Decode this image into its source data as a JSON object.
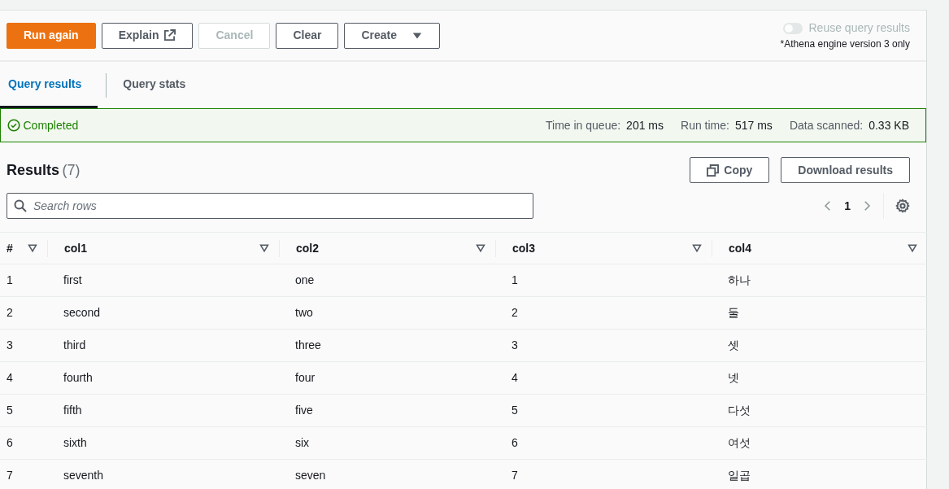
{
  "toolbar": {
    "buttons": [
      {
        "label": "Run again",
        "kind": "primary"
      },
      {
        "label": "Explain",
        "kind": "external"
      },
      {
        "label": "Cancel",
        "kind": "disabled"
      },
      {
        "label": "Clear",
        "kind": "plain"
      },
      {
        "label": "Create",
        "kind": "dropdown"
      }
    ],
    "reuse_toggle": {
      "label": "Reuse query results",
      "on": false,
      "disabled": true,
      "note": "*Athena engine version 3 only"
    }
  },
  "tabs": [
    {
      "label": "Query results",
      "selected": true
    },
    {
      "label": "Query stats",
      "selected": false
    }
  ],
  "status": {
    "label": "Completed",
    "stats": [
      {
        "label": "Time in queue:",
        "value": "201 ms"
      },
      {
        "label": "Run time:",
        "value": "517 ms"
      },
      {
        "label": "Data scanned:",
        "value": "0.33 KB"
      }
    ]
  },
  "results": {
    "title": "Results",
    "count": "(7)",
    "buttons": [
      {
        "label": "Copy",
        "kind": "copy"
      },
      {
        "label": "Download results",
        "kind": "plain"
      }
    ],
    "search": {
      "placeholder": "Search rows"
    },
    "page": "1"
  },
  "table": {
    "columns": [
      "#",
      "col1",
      "col2",
      "col3",
      "col4"
    ],
    "rows": [
      [
        "1",
        "first",
        "one",
        "1",
        "하나"
      ],
      [
        "2",
        "second",
        "two",
        "2",
        "둘"
      ],
      [
        "3",
        "third",
        "three",
        "3",
        "셋"
      ],
      [
        "4",
        "fourth",
        "four",
        "4",
        "넷"
      ],
      [
        "5",
        "fifth",
        "five",
        "5",
        "다섯"
      ],
      [
        "6",
        "sixth",
        "six",
        "6",
        "여섯"
      ],
      [
        "7",
        "seventh",
        "seven",
        "7",
        "일곱"
      ]
    ]
  }
}
